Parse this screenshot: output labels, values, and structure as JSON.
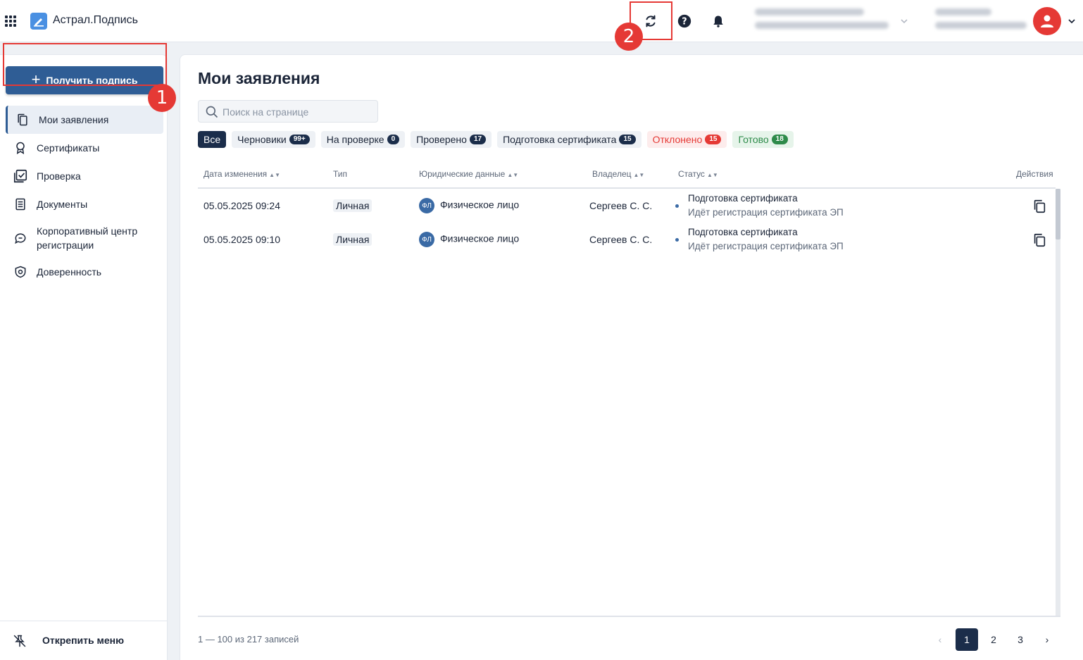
{
  "header": {
    "app_title": "Астрал.Подпись",
    "markers": {
      "m1": "1",
      "m2": "2"
    },
    "icons": [
      "apps-grid-icon",
      "logo-icon",
      "refresh-icon",
      "help-icon",
      "bell-icon",
      "chevron-down-icon",
      "user-avatar-icon"
    ]
  },
  "sidebar": {
    "primary_button": "Получить подпись",
    "items": [
      {
        "label": "Мои заявления",
        "icon": "documents-copy-icon",
        "active": true
      },
      {
        "label": "Сертификаты",
        "icon": "award-icon"
      },
      {
        "label": "Проверка",
        "icon": "check-square-icon"
      },
      {
        "label": "Документы",
        "icon": "document-icon"
      },
      {
        "label": "Корпоративный центр регистрации",
        "icon": "chat-icon"
      },
      {
        "label": "Доверенность",
        "icon": "shield-icon"
      }
    ],
    "unpin_label": "Открепить меню"
  },
  "main": {
    "title": "Мои заявления",
    "search_placeholder": "Поиск на странице",
    "filters": [
      {
        "label": "Все",
        "count": null,
        "selected": true
      },
      {
        "label": "Черновики",
        "count": "99+"
      },
      {
        "label": "На проверке",
        "count": "0"
      },
      {
        "label": "Проверено",
        "count": "17"
      },
      {
        "label": "Подготовка сертификата",
        "count": "15"
      },
      {
        "label": "Отклонено",
        "count": "15"
      },
      {
        "label": "Готово",
        "count": "18"
      }
    ],
    "columns": {
      "date": "Дата изменения",
      "type": "Тип",
      "legal": "Юридические данные",
      "owner": "Владелец",
      "status": "Статус",
      "actions": "Действия"
    },
    "rows": [
      {
        "date": "05.05.2025 09:24",
        "type": "Личная",
        "legal_badge": "ФЛ",
        "legal": "Физическое лицо",
        "owner": "Сергеев С. С.",
        "status_title": "Подготовка сертификата",
        "status_sub": "Идёт регистрация сертификата ЭП"
      },
      {
        "date": "05.05.2025 09:10",
        "type": "Личная",
        "legal_badge": "ФЛ",
        "legal": "Физическое лицо",
        "owner": "Сергеев С. С.",
        "status_title": "Подготовка сертификата",
        "status_sub": "Идёт регистрация сертификата ЭП"
      }
    ],
    "records_text": "1 — 100 из 217 записей",
    "pagination": {
      "prev": "‹",
      "pages": [
        "1",
        "2",
        "3"
      ],
      "current": "1",
      "next": "›"
    }
  },
  "colors": {
    "accent": "#2f5d95",
    "dark_navy": "#1b2d4a",
    "highlight_red": "#e53935",
    "success_green": "#2e8b4a"
  }
}
